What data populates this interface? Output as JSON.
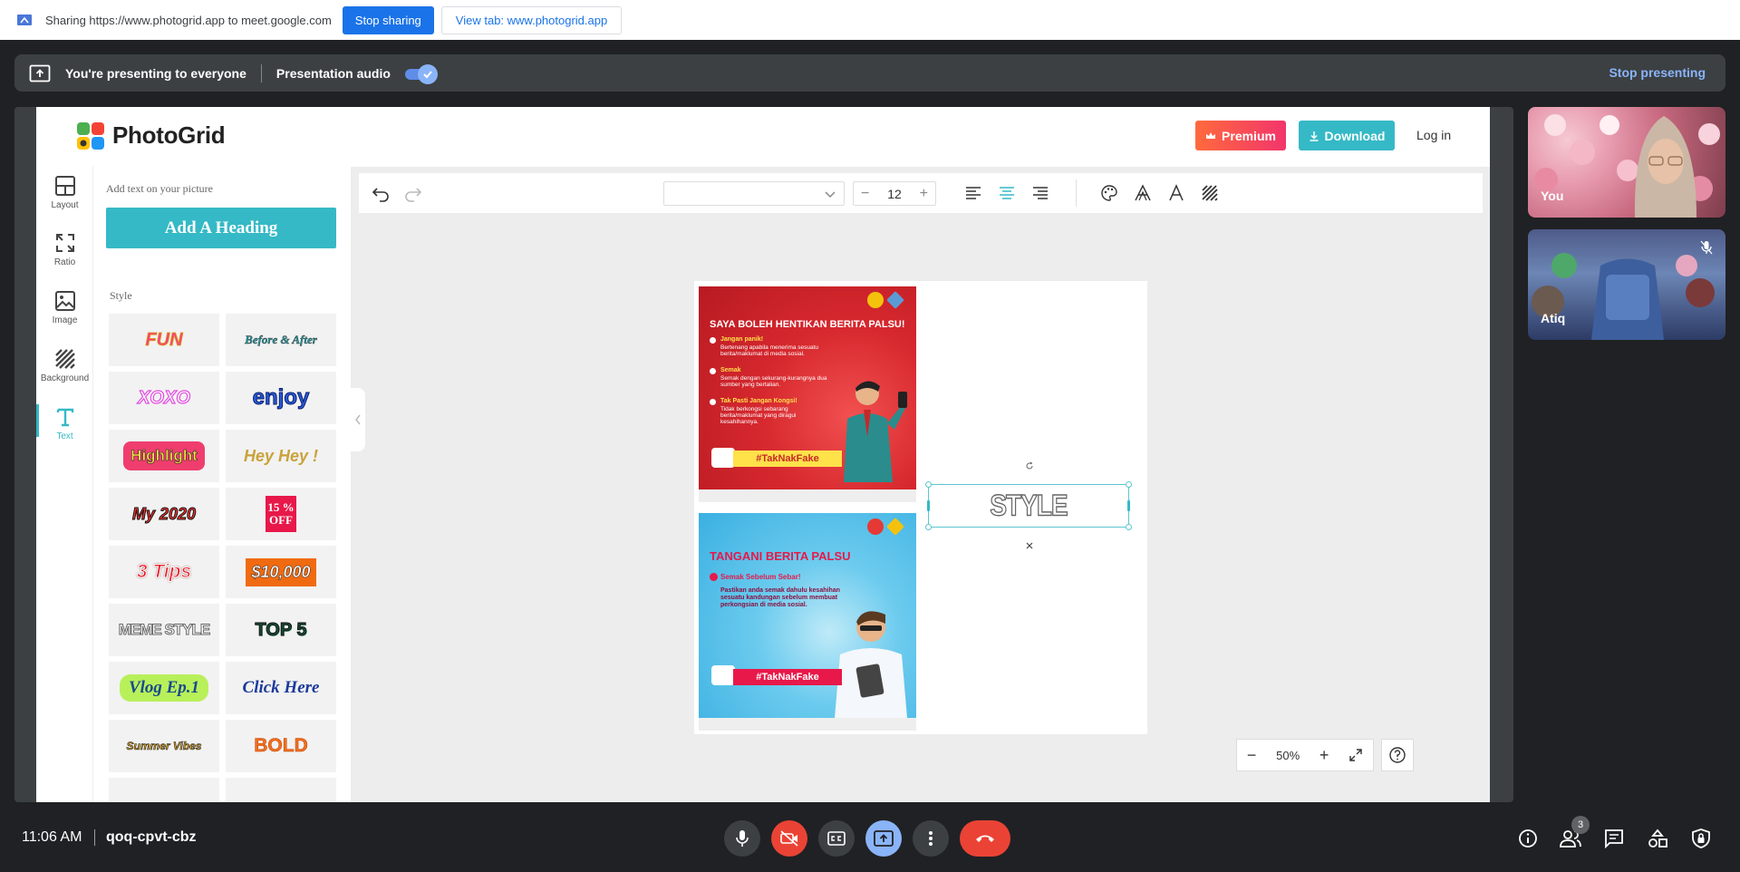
{
  "share_bar": {
    "text": "Sharing https://www.photogrid.app to meet.google.com",
    "stop_sharing": "Stop sharing",
    "view_tab": "View tab: www.photogrid.app"
  },
  "present_bar": {
    "presenting": "You're presenting to everyone",
    "audio": "Presentation audio",
    "audio_on": true,
    "stop": "Stop presenting"
  },
  "photogrid": {
    "brand": "PhotoGrid",
    "premium": "Premium",
    "download": "Download",
    "login": "Log in",
    "rail": [
      {
        "label": "Layout",
        "icon": "layout-icon"
      },
      {
        "label": "Ratio",
        "icon": "expand-icon"
      },
      {
        "label": "Image",
        "icon": "image-icon"
      },
      {
        "label": "Background",
        "icon": "background-icon"
      },
      {
        "label": "Text",
        "icon": "text-icon"
      }
    ],
    "panel": {
      "hint": "Add text on your picture",
      "add_heading": "Add A Heading",
      "style_label": "Style",
      "styles": [
        "FUN",
        "Before & After",
        "XOXO",
        "enjoy",
        "Highlight",
        "Hey Hey !",
        "My 2020",
        "15 % OFF",
        "3 Tips",
        "$10,000",
        "MEME STYLE",
        "TOP 5",
        "Vlog Ep.1",
        "Click Here",
        "Summer Vibes",
        "BOLD"
      ]
    },
    "toolbar": {
      "font_size": "12",
      "minus": "−",
      "plus": "+"
    },
    "canvas": {
      "poster1": {
        "title": "SAYA BOLEH HENTIKAN BERITA PALSU!",
        "items": [
          {
            "head": "Jangan panik!",
            "body": "Bertenang apabila menerima sesuatu berita/maklumat di media sosial."
          },
          {
            "head": "Semak",
            "body": "Semak dengan sekurang-kurangnya dua sumber yang bertalian."
          },
          {
            "head": "Tak Pasti Jangan Kongsi!",
            "body": "Tidak berkongsi sebarang berita/maklumat yang diragui kesahihannya."
          }
        ],
        "tag": "#TakNakFake"
      },
      "poster2": {
        "title": "TANGANI BERITA PALSU",
        "subtitle": "Semak Sebelum Sebar!",
        "body": "Pastikan anda semak dahulu kesahihan sesuatu kandungan sebelum membuat perkongsian di media sosial.",
        "tag": "#TakNakFake"
      },
      "selected_text": "STYLE"
    },
    "zoom": {
      "value": "50%",
      "minus": "−",
      "plus": "+"
    }
  },
  "participants": [
    {
      "name": "You"
    },
    {
      "name": "Atiq",
      "muted": true
    }
  ],
  "bottom_bar": {
    "time": "11:06 AM",
    "meeting_code": "qoq-cpvt-cbz",
    "people_count": "3"
  },
  "colors": {
    "accent": "#35b9c6",
    "meet_blue": "#1a73e8",
    "end_call": "#ea4335"
  }
}
